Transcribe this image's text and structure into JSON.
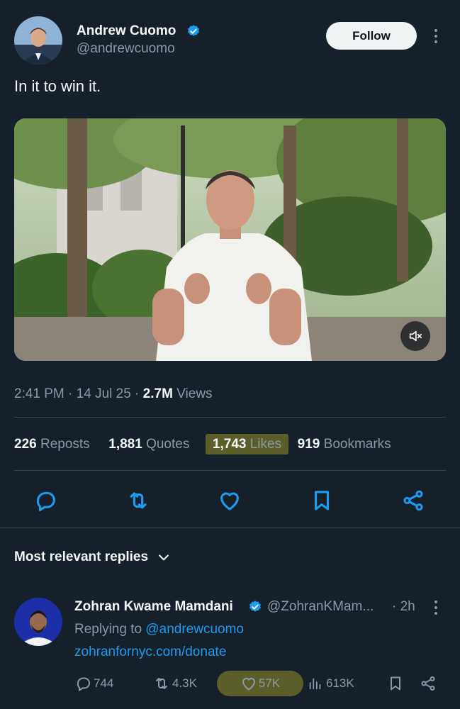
{
  "author": {
    "name": "Andrew Cuomo",
    "handle": "@andrewcuomo",
    "follow_label": "Follow"
  },
  "tweet": {
    "text": "In it to win it.",
    "time": "2:41 PM",
    "date": "14 Jul 25",
    "views_count": "2.7M",
    "views_label": "Views"
  },
  "stats": {
    "reposts_count": "226",
    "reposts_label": "Reposts",
    "quotes_count": "1,881",
    "quotes_label": "Quotes",
    "likes_count": "1,743",
    "likes_label": "Likes",
    "bookmarks_count": "919",
    "bookmarks_label": "Bookmarks"
  },
  "replies": {
    "sort_label": "Most relevant replies"
  },
  "reply": {
    "name": "Zohran Kwame Mamdani",
    "handle": "@ZohranKMam...",
    "time": "· 2h",
    "replying_prefix": "Replying to",
    "replying_handle": "@andrewcuomo",
    "link": "zohranfornyc.com/donate",
    "comments": "744",
    "reposts": "4.3K",
    "likes": "57K",
    "views": "613K"
  },
  "icons": {
    "verified": "verified-badge-icon",
    "mute": "volume-muted-icon",
    "reply": "reply-icon",
    "repost": "repost-icon",
    "like": "heart-icon",
    "bookmark": "bookmark-icon",
    "share": "share-icon",
    "views": "analytics-icon",
    "more": "more-icon",
    "chevron": "chevron-down-icon"
  },
  "colors": {
    "background": "#15202b",
    "accent": "#1d9bf0",
    "muted": "#8b98a5",
    "divider": "#38444d"
  }
}
